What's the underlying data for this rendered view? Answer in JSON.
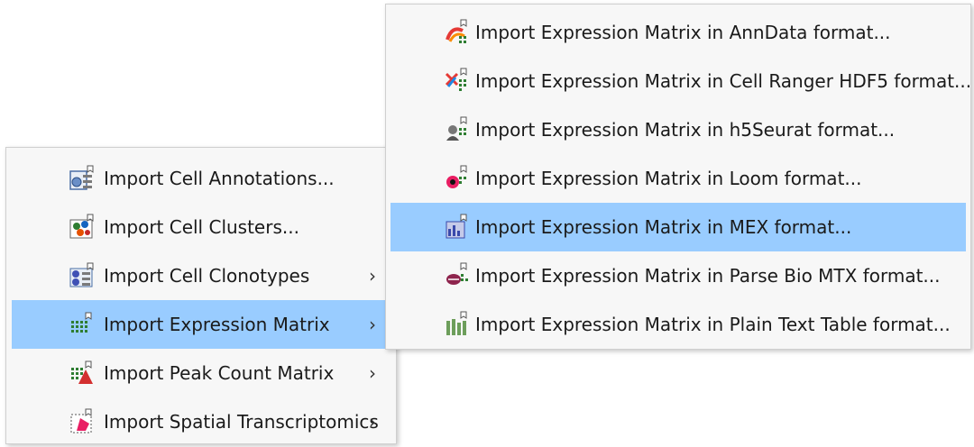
{
  "main_menu": {
    "items": [
      {
        "label": "Import Cell Annotations...",
        "icon": "cell-annotations-icon",
        "submenu": false
      },
      {
        "label": "Import Cell Clusters...",
        "icon": "cell-clusters-icon",
        "submenu": false
      },
      {
        "label": "Import Cell Clonotypes",
        "icon": "cell-clonotypes-icon",
        "submenu": true
      },
      {
        "label": "Import Expression Matrix",
        "icon": "expression-matrix-icon",
        "submenu": true,
        "highlighted": true
      },
      {
        "label": "Import Peak Count Matrix",
        "icon": "peak-count-matrix-icon",
        "submenu": true
      },
      {
        "label": "Import Spatial Transcriptomics",
        "icon": "spatial-transcriptomics-icon",
        "submenu": true
      }
    ],
    "arrow": "›"
  },
  "sub_menu": {
    "items": [
      {
        "label": "Import Expression Matrix in AnnData format...",
        "icon": "anndata-icon"
      },
      {
        "label": "Import Expression Matrix in Cell Ranger HDF5 format...",
        "icon": "cell-ranger-icon"
      },
      {
        "label": "Import Expression Matrix in h5Seurat format...",
        "icon": "h5seurat-icon"
      },
      {
        "label": "Import Expression Matrix in Loom format...",
        "icon": "loom-icon"
      },
      {
        "label": "Import Expression Matrix in MEX format...",
        "icon": "mex-icon",
        "highlighted": true
      },
      {
        "label": "Import Expression Matrix in Parse Bio MTX format...",
        "icon": "parse-bio-icon"
      },
      {
        "label": "Import Expression Matrix in Plain Text Table format...",
        "icon": "plain-text-table-icon"
      }
    ]
  },
  "colors": {
    "highlight": "#99ccff",
    "menu_bg": "#f7f7f7"
  }
}
